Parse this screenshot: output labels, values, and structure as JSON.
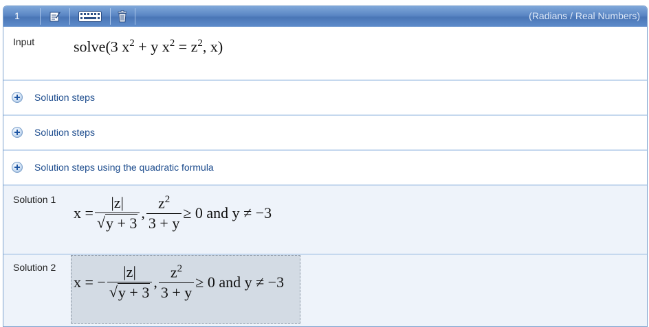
{
  "toolbar": {
    "cell_number": "1",
    "edit_icon": "edit-icon",
    "keyboard_icon": "keyboard-icon",
    "delete_icon": "trash-icon",
    "mode_text": "(Radians / Real Numbers)"
  },
  "input": {
    "label": "Input",
    "expr_func": "solve",
    "expr_lhs": "3 x",
    "expr_mid": " + y x",
    "exp": "2",
    "eq": " = z",
    "tail": ", x)"
  },
  "steps": [
    {
      "label": "Solution steps"
    },
    {
      "label": "Solution steps"
    },
    {
      "label": "Solution steps using the quadratic formula"
    }
  ],
  "solutions": [
    {
      "label": "Solution 1",
      "lhs": "x = ",
      "frac1_num": "|z|",
      "frac1_den": "y + 3",
      "frac2_num_base": "z",
      "frac2_num_exp": "2",
      "frac2_den": "3 + y",
      "condition": "≥ 0 and y ≠ −3"
    },
    {
      "label": "Solution 2",
      "lhs": "x = −",
      "frac1_num": "|z|",
      "frac1_den": "y + 3",
      "frac2_num_base": "z",
      "frac2_num_exp": "2",
      "frac2_den": "3 + y",
      "condition": "≥ 0 and y ≠ −3"
    }
  ],
  "colors": {
    "toolbar": "#5a86c4",
    "steps_text": "#1a4a8c",
    "solution_bg": "#eef3fa",
    "selection_bg": "#d3dbe4"
  }
}
